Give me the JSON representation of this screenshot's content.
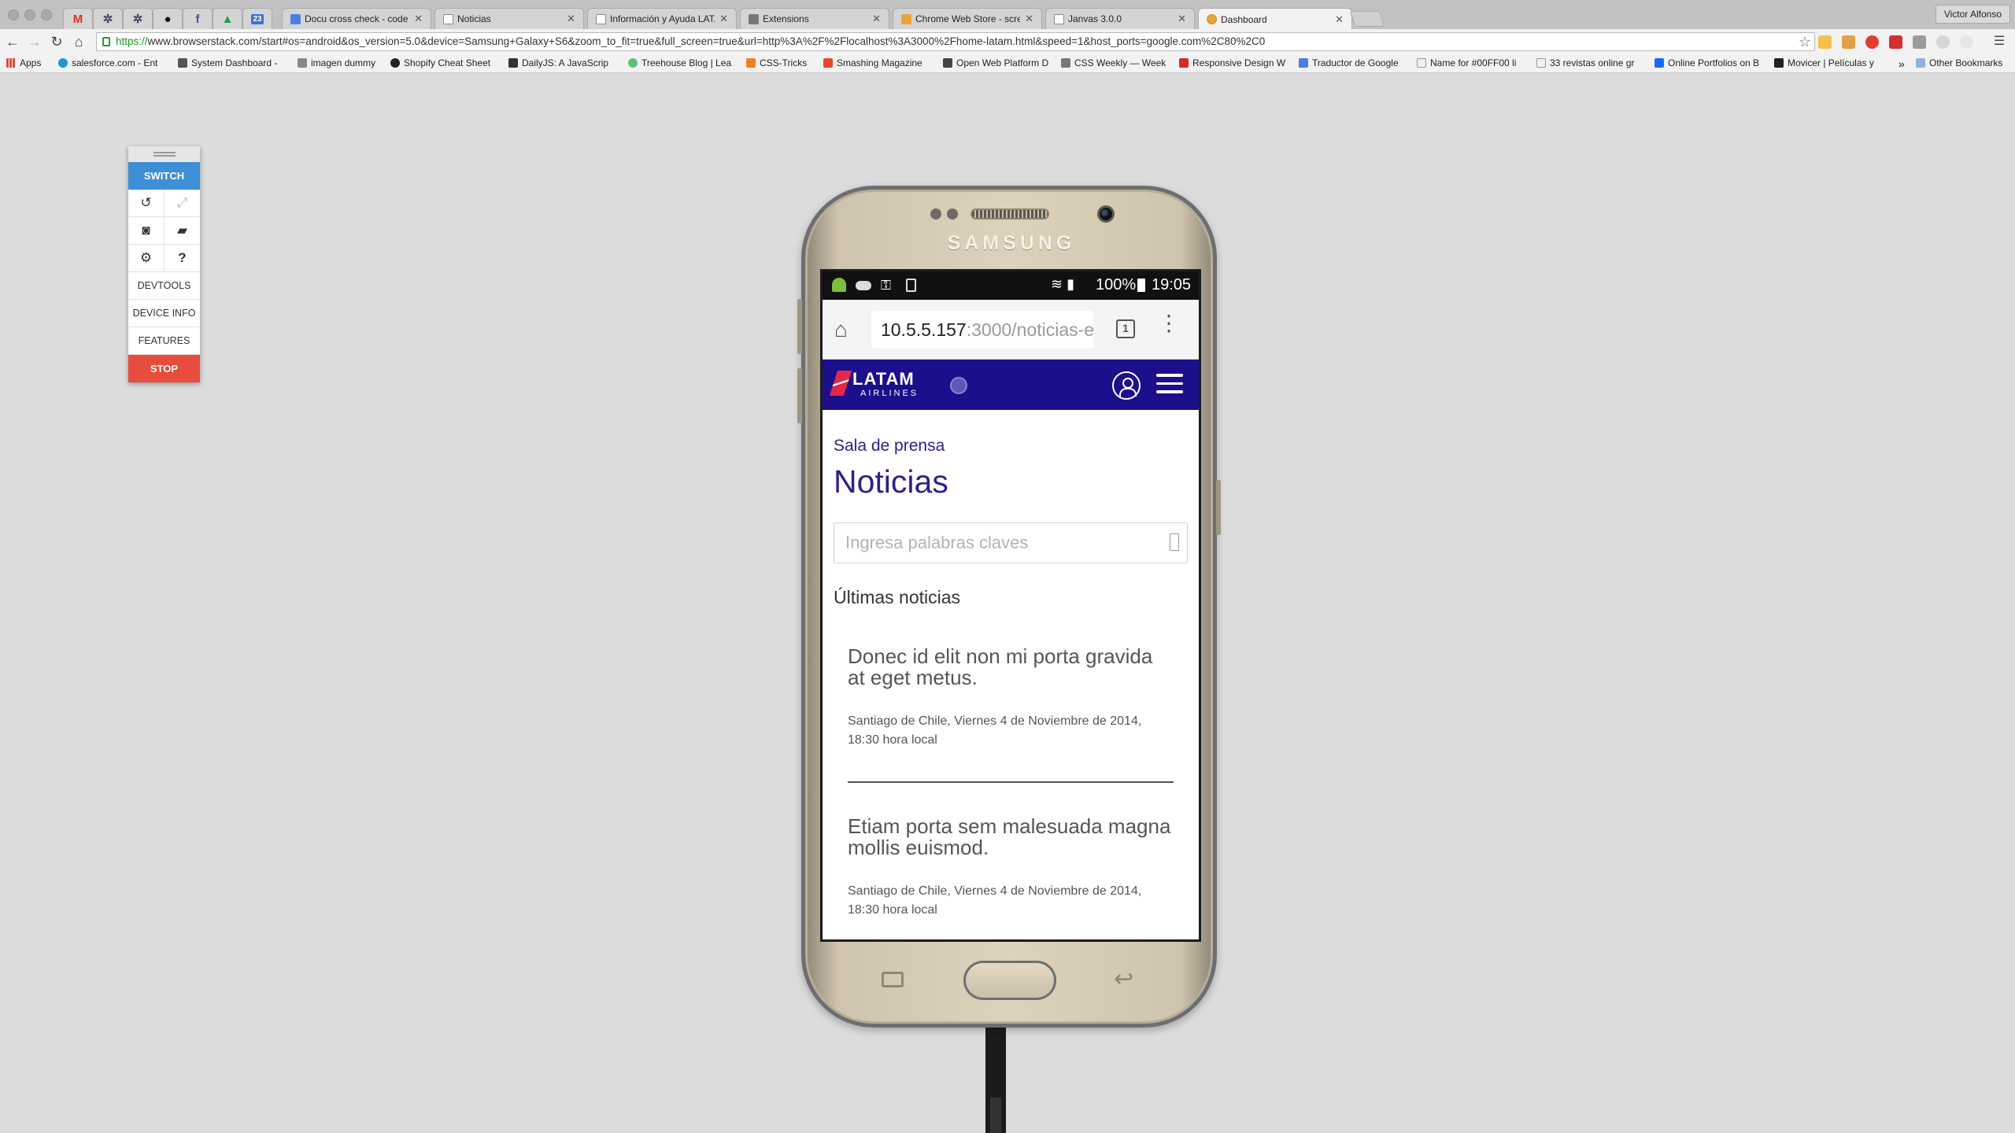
{
  "browser": {
    "pinned_tabs": [
      "gmail-icon",
      "network-icon",
      "network-icon",
      "github-icon",
      "facebook-icon",
      "drive-icon",
      "calendar-icon"
    ],
    "calendar_day": "23",
    "tabs": [
      {
        "title": "Docu cross check - code r",
        "icon": "docs-icon",
        "active": false
      },
      {
        "title": "Noticias",
        "icon": "page-icon",
        "active": false
      },
      {
        "title": "Información y Ayuda LATAM",
        "icon": "page-icon",
        "active": false
      },
      {
        "title": "Extensions",
        "icon": "puzzle-icon",
        "active": false
      },
      {
        "title": "Chrome Web Store - screen",
        "icon": "webstore-icon",
        "active": false
      },
      {
        "title": "Janvas 3.0.0",
        "icon": "page-icon",
        "active": false
      },
      {
        "title": "Dashboard",
        "icon": "browserstack-icon",
        "active": true
      }
    ],
    "profile_name": "Victor Alfonso",
    "url_scheme": "https://",
    "url_rest": "www.browserstack.com/start#os=android&os_version=5.0&device=Samsung+Galaxy+S6&zoom_to_fit=true&full_screen=true&url=http%3A%2F%2Flocalhost%3A3000%2Fhome-latam.html&speed=1&host_ports=google.com%2C80%2C0",
    "bookmarks": [
      {
        "label": "Apps",
        "color": "#e0463a"
      },
      {
        "label": "salesforce.com - Ent",
        "color": "#1b96d6"
      },
      {
        "label": "System Dashboard -",
        "color": "#555555"
      },
      {
        "label": "imagen dummy",
        "color": "#888888"
      },
      {
        "label": "Shopify Cheat Sheet",
        "color": "#222222"
      },
      {
        "label": "DailyJS: A JavaScrip",
        "color": "#333333"
      },
      {
        "label": "Treehouse Blog | Lea",
        "color": "#5fbf7a"
      },
      {
        "label": "CSS-Tricks",
        "color": "#f08020"
      },
      {
        "label": "Smashing Magazine",
        "color": "#e8452c"
      },
      {
        "label": "Open Web Platform D",
        "color": "#444444"
      },
      {
        "label": "CSS Weekly — Week",
        "color": "#777777"
      },
      {
        "label": "Responsive Design W",
        "color": "#d42b2b"
      },
      {
        "label": "Traductor de Google",
        "color": "#4a7fe0"
      },
      {
        "label": "Name for #00FF00 li",
        "color": "#999999"
      },
      {
        "label": "33 revistas online gr",
        "color": "#999999"
      },
      {
        "label": "Online Portfolios on B",
        "color": "#1769ff"
      },
      {
        "label": "Movicer | Películas y",
        "color": "#222222"
      }
    ],
    "bookmarks_overflow": "»",
    "other_bookmarks": "Other Bookmarks"
  },
  "browserstack": {
    "switch_label": "SWITCH",
    "devtools_label": "DEVTOOLS",
    "device_info_label": "DEVICE INFO",
    "features_label": "FEATURES",
    "stop_label": "STOP"
  },
  "device": {
    "brand": "SAMSUNG",
    "status": {
      "battery": "100%",
      "time": "19:05"
    },
    "url_host": "10.5.5.157",
    "url_path": ":3000/noticias-e",
    "tab_count": "1",
    "latam": {
      "logo": "LATAM",
      "sub": "AIRLINES"
    },
    "page": {
      "kicker": "Sala de prensa",
      "title": "Noticias",
      "search_placeholder": "Ingresa palabras claves",
      "section_title": "Últimas noticias",
      "news": [
        {
          "title": "Donec id elit non mi porta gravida at eget metus.",
          "meta": "Santiago de Chile, Viernes 4 de Noviembre de 2014, 18:30 hora local"
        },
        {
          "title": "Etiam porta sem malesuada magna mollis euismod.",
          "meta": "Santiago de Chile, Viernes 4 de Noviembre de 2014, 18:30 hora local"
        }
      ]
    }
  }
}
